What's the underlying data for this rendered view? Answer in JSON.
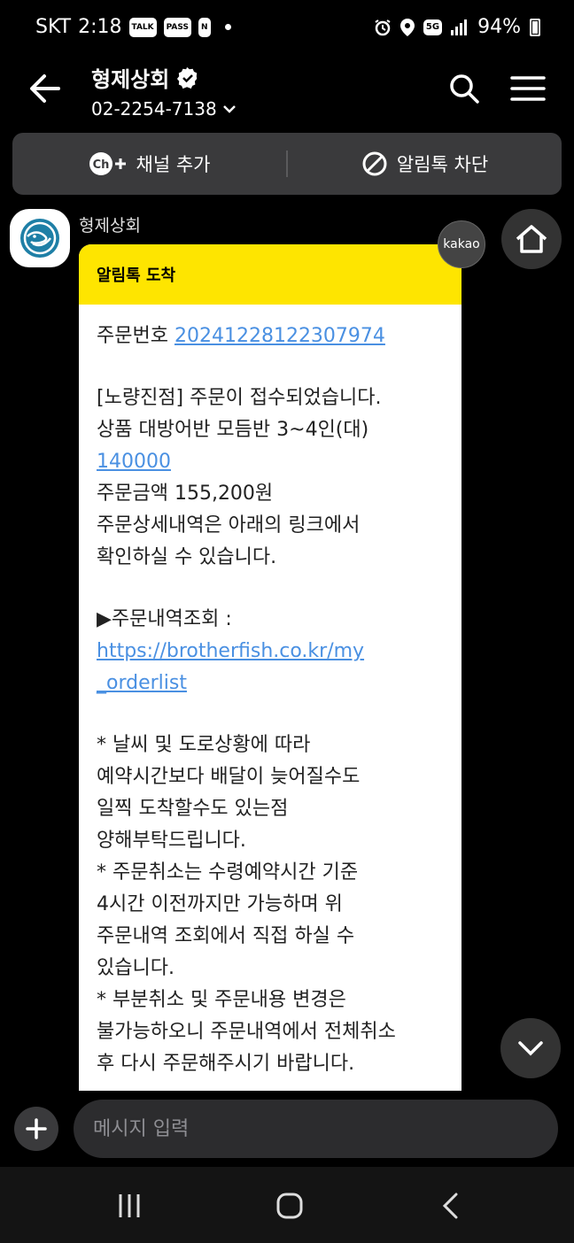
{
  "status_bar": {
    "carrier": "SKT",
    "time": "2:18",
    "badges": [
      "TALK",
      "PASS",
      "N"
    ],
    "network": "5G",
    "battery": "94%"
  },
  "header": {
    "title": "형제상회",
    "phone": "02-2254-7138",
    "icons": [
      "back-arrow-icon",
      "verified-badge-icon",
      "chevron-down-icon",
      "search-icon",
      "menu-icon"
    ]
  },
  "actions": {
    "add_channel": "채널 추가",
    "ch_badge": "Ch",
    "block_alimtalk": "알림톡 차단"
  },
  "message": {
    "sender": "형제상회",
    "kakao_badge": "kakao",
    "head": "알림톡 도착",
    "order_label": "주문번호",
    "order_number": "20241228122307974",
    "lines1": [
      "[노량진점] 주문이 접수되었습니다.",
      "상품 대방어반 모듬반 3~4인(대)"
    ],
    "price_link": "140000",
    "lines2": [
      "주문금액 155,200원",
      "주문상세내역은 아래의 링크에서",
      "확인하실 수 있습니다."
    ],
    "inquiry_label": "▶주문내역조회 :",
    "url_line1": "https://brotherfish.co.kr/my",
    "url_line2": "_orderlist",
    "notes": [
      "* 날씨 및 도로상황에 따라",
      "예약시간보다 배달이 늦어질수도",
      "일찍 도착할수도 있는점",
      "양해부탁드립니다.",
      "* 주문취소는 수령예약시간 기준",
      "4시간 이전까지만 가능하며 위",
      "주문내역 조회에서 직접 하실 수",
      "있습니다.",
      "* 부분취소 및 주문내용 변경은",
      "불가능하오니 주문내역에서 전체취소",
      "후 다시 주문해주시기 바랍니다."
    ]
  },
  "input": {
    "placeholder": "메시지 입력"
  },
  "colors": {
    "accent_yellow": "#fee500",
    "link_blue": "#4a90e2",
    "background": "#000000"
  }
}
